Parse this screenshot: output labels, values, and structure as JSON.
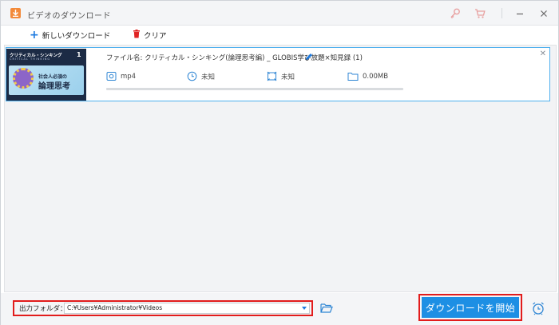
{
  "window": {
    "title": "ビデオのダウンロード"
  },
  "toolbar": {
    "new_download": "新しいダウンロード",
    "clear": "クリア"
  },
  "download_item": {
    "file_name": "ファイル名: クリティカル・シンキング(論理思考編) _ GLOBIS学び放題×知見録 (1)",
    "format": "mp4",
    "duration": "未知",
    "resolution": "未知",
    "size": "0.00MB",
    "progress": 0,
    "thumbnail": {
      "title": "クリティカル・シンキング",
      "subtitle": "CRITICAL THINKING",
      "number": "1",
      "small_text": "社会人必須の",
      "big_text": "論理思考"
    }
  },
  "bottom": {
    "folder_label": "出力フォルダ：",
    "folder_path": "C:¥Users¥Administrator¥Videos",
    "start_button": "ダウンロードを開始"
  },
  "colors": {
    "accent": "#1d8fe4",
    "highlight": "#e21c1c",
    "app_icon": "#f38a3a"
  }
}
